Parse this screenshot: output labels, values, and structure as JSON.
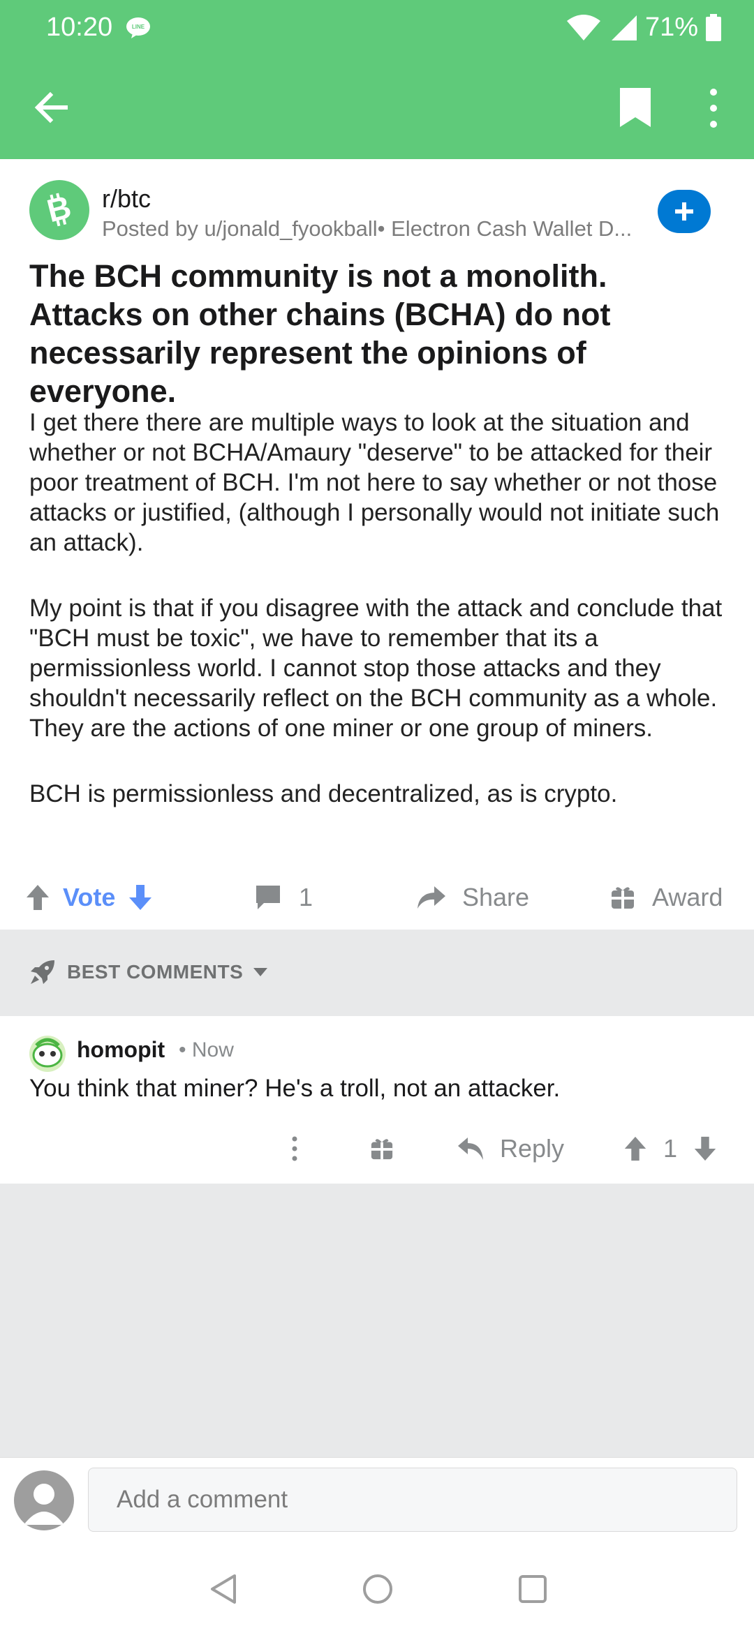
{
  "status_bar": {
    "time": "10:20",
    "battery": "71%"
  },
  "post": {
    "subreddit": "r/btc",
    "posted_by": "Posted by u/jonald_fyookball• Electron Cash Wallet D...",
    "title": "The BCH community is not a monolith. Attacks on other chains (BCHA) do not necessarily represent the opinions of everyone.",
    "body": [
      "I get there there are multiple ways to look at the situation and whether or not BCHA/Amaury \"deserve\" to be attacked for their poor treatment of BCH.  I'm not here to say whether or not those attacks or justified, (although I personally would not initiate such an attack).",
      "My point is that if you disagree with the attack and conclude that \"BCH must be toxic\", we have to remember that its a permissionless world.  I cannot stop those attacks and they shouldn't necessarily reflect on the BCH community as a whole.  They are the actions of one miner or one group of miners.",
      "BCH is permissionless and decentralized, as is crypto."
    ]
  },
  "actions": {
    "vote": "Vote",
    "comments": "1",
    "share": "Share",
    "award": "Award"
  },
  "sort": {
    "label": "BEST COMMENTS"
  },
  "comment": {
    "author": "homopit",
    "time": "• Now",
    "body": "You think that miner? He's a troll, not an attacker.",
    "reply": "Reply",
    "score": "1"
  },
  "composer": {
    "placeholder": "Add a comment"
  },
  "colors": {
    "header": "#5fca7a",
    "vote_accent": "#5b8ff9",
    "join_button": "#0079d3"
  },
  "icons": [
    "line-icon",
    "wifi-icon",
    "signal-icon",
    "battery-icon",
    "back-arrow-icon",
    "bookmark-icon",
    "overflow-menu-icon",
    "bitcoin-cash-icon",
    "plus-icon",
    "upvote-icon",
    "downvote-icon",
    "comment-icon",
    "share-icon",
    "award-icon",
    "rocket-icon",
    "caret-down-icon",
    "reply-icon",
    "user-avatar-icon",
    "nav-back-icon",
    "nav-home-icon",
    "nav-recents-icon"
  ]
}
